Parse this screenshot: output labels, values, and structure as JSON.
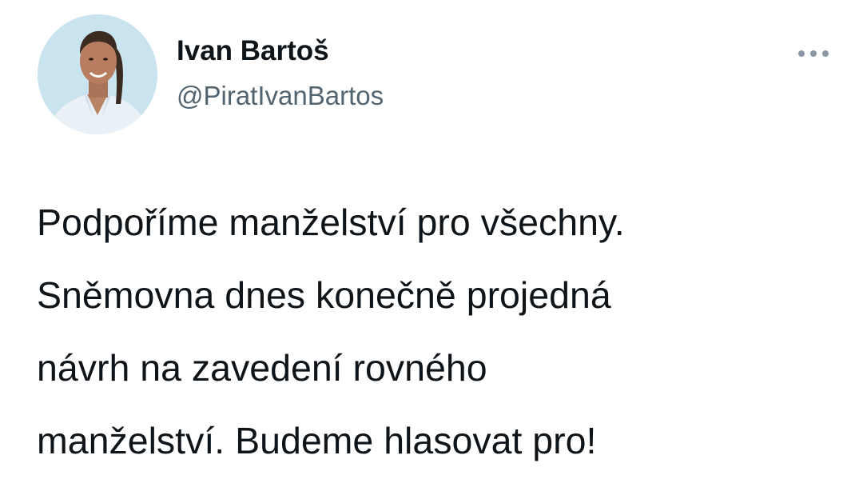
{
  "author": {
    "name": "Ivan Bartoš",
    "handle": "@PiratIvanBartos",
    "avatar_icon": "profile-photo"
  },
  "more_icon": "more-horizontal-icon",
  "tweet": {
    "text": "Podpoříme manželství pro všechny.\nSněmovna dnes konečně projedná\nnávrh na zavedení rovného\nmanželství. Budeme hlasovat pro!"
  },
  "colors": {
    "text": "#0f1419",
    "secondary": "#536471",
    "avatar_background": "#c8e2ee"
  }
}
